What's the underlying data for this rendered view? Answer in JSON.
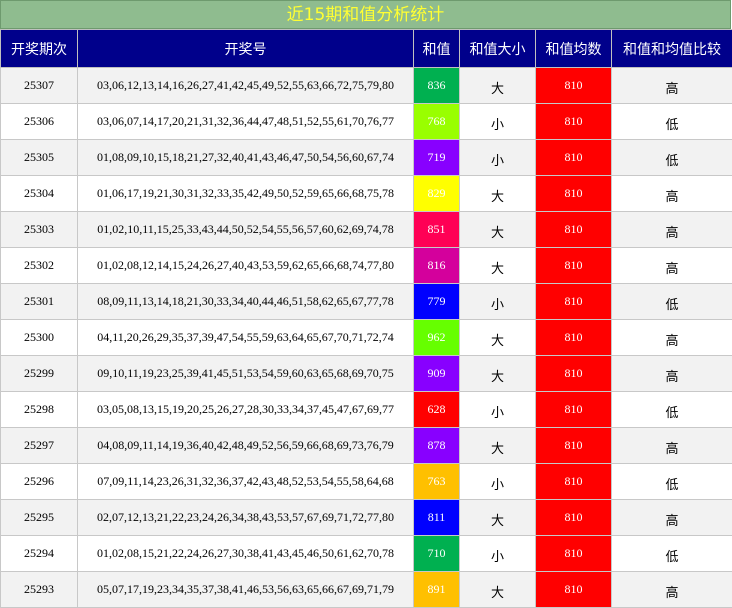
{
  "title": "近15期和值分析统计",
  "headers": [
    "开奖期次",
    "开奖号",
    "和值",
    "和值大小",
    "和值均数",
    "和值和均值比较"
  ],
  "rows": [
    {
      "period": "25307",
      "numbers": "03,06,12,13,14,16,26,27,41,42,45,49,52,55,63,66,72,75,79,80",
      "sum": "836",
      "sum_color": "#00b050",
      "size": "大",
      "avg": "810",
      "compare": "高"
    },
    {
      "period": "25306",
      "numbers": "03,06,07,14,17,20,21,31,32,36,44,47,48,51,52,55,61,70,76,77",
      "sum": "768",
      "sum_color": "#99ff00",
      "size": "小",
      "avg": "810",
      "compare": "低"
    },
    {
      "period": "25305",
      "numbers": "01,08,09,10,15,18,21,27,32,40,41,43,46,47,50,54,56,60,67,74",
      "sum": "719",
      "sum_color": "#8800ff",
      "size": "小",
      "avg": "810",
      "compare": "低"
    },
    {
      "period": "25304",
      "numbers": "01,06,17,19,21,30,31,32,33,35,42,49,50,52,59,65,66,68,75,78",
      "sum": "829",
      "sum_color": "#ffff00",
      "size": "大",
      "avg": "810",
      "compare": "高"
    },
    {
      "period": "25303",
      "numbers": "01,02,10,11,15,25,33,43,44,50,52,54,55,56,57,60,62,69,74,78",
      "sum": "851",
      "sum_color": "#ff0055",
      "size": "大",
      "avg": "810",
      "compare": "高"
    },
    {
      "period": "25302",
      "numbers": "01,02,08,12,14,15,24,26,27,40,43,53,59,62,65,66,68,74,77,80",
      "sum": "816",
      "sum_color": "#d4009c",
      "size": "大",
      "avg": "810",
      "compare": "高"
    },
    {
      "period": "25301",
      "numbers": "08,09,11,13,14,18,21,30,33,34,40,44,46,51,58,62,65,67,77,78",
      "sum": "779",
      "sum_color": "#0000ff",
      "size": "小",
      "avg": "810",
      "compare": "低"
    },
    {
      "period": "25300",
      "numbers": "04,11,20,26,29,35,37,39,47,54,55,59,63,64,65,67,70,71,72,74",
      "sum": "962",
      "sum_color": "#66ff00",
      "size": "大",
      "avg": "810",
      "compare": "高"
    },
    {
      "period": "25299",
      "numbers": "09,10,11,19,23,25,39,41,45,51,53,54,59,60,63,65,68,69,70,75",
      "sum": "909",
      "sum_color": "#8800ff",
      "size": "大",
      "avg": "810",
      "compare": "高"
    },
    {
      "period": "25298",
      "numbers": "03,05,08,13,15,19,20,25,26,27,28,30,33,34,37,45,47,67,69,77",
      "sum": "628",
      "sum_color": "#ff0000",
      "size": "小",
      "avg": "810",
      "compare": "低"
    },
    {
      "period": "25297",
      "numbers": "04,08,09,11,14,19,36,40,42,48,49,52,56,59,66,68,69,73,76,79",
      "sum": "878",
      "sum_color": "#8800ff",
      "size": "大",
      "avg": "810",
      "compare": "高"
    },
    {
      "period": "25296",
      "numbers": "07,09,11,14,23,26,31,32,36,37,42,43,48,52,53,54,55,58,64,68",
      "sum": "763",
      "sum_color": "#ffc000",
      "size": "小",
      "avg": "810",
      "compare": "低"
    },
    {
      "period": "25295",
      "numbers": "02,07,12,13,21,22,23,24,26,34,38,43,53,57,67,69,71,72,77,80",
      "sum": "811",
      "sum_color": "#0000ff",
      "size": "大",
      "avg": "810",
      "compare": "高"
    },
    {
      "period": "25294",
      "numbers": "01,02,08,15,21,22,24,26,27,30,38,41,43,45,46,50,61,62,70,78",
      "sum": "710",
      "sum_color": "#00b050",
      "size": "小",
      "avg": "810",
      "compare": "低"
    },
    {
      "period": "25293",
      "numbers": "05,07,17,19,23,34,35,37,38,41,46,53,56,63,65,66,67,69,71,79",
      "sum": "891",
      "sum_color": "#ffc000",
      "size": "大",
      "avg": "810",
      "compare": "高"
    }
  ]
}
